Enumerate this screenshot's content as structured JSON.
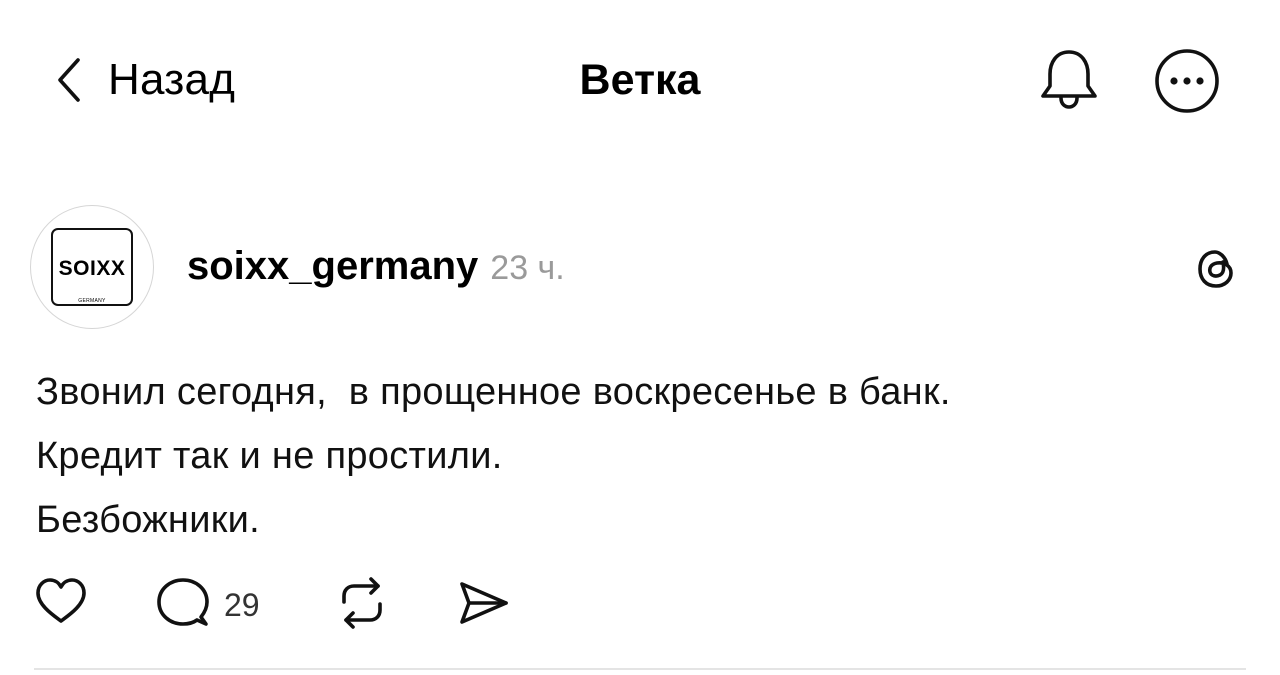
{
  "header": {
    "back_label": "Назад",
    "title": "Ветка"
  },
  "post": {
    "avatar": {
      "brand_text": "SOIXX",
      "sub_text": "GERMANY"
    },
    "username": "soixx_germany",
    "timestamp": "23 ч.",
    "text_lines": [
      "Звонил сегодня,  в прощенное воскресенье в банк.",
      "Кредит так и не простили.",
      "Безбожники."
    ],
    "actions": {
      "reply_count": "29"
    }
  },
  "icons": {
    "back": "chevron-left-icon",
    "notifications": "bell-icon",
    "more": "more-icon",
    "app": "threads-logo-icon",
    "like": "heart-icon",
    "reply": "comment-icon",
    "repost": "repost-icon",
    "share": "send-icon"
  },
  "colors": {
    "text": "#000000",
    "muted": "#9a9a9a",
    "divider": "#e4e4e4"
  }
}
